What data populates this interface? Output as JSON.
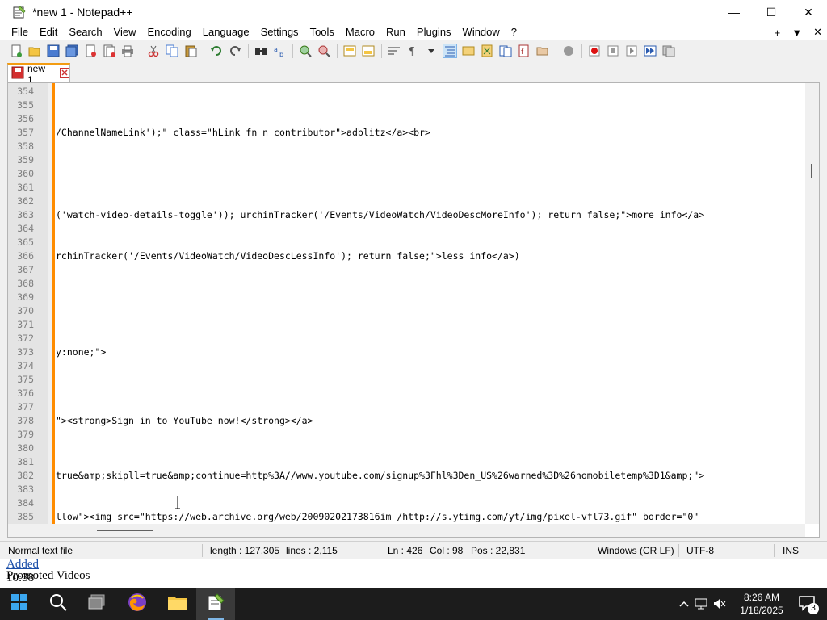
{
  "window": {
    "title": "*new 1 - Notepad++",
    "minimize": "—",
    "maximize": "☐",
    "close": "✕"
  },
  "menu": {
    "items": [
      "File",
      "Edit",
      "Search",
      "View",
      "Encoding",
      "Language",
      "Settings",
      "Tools",
      "Macro",
      "Run",
      "Plugins",
      "Window",
      "?"
    ],
    "right": [
      "+",
      "▼",
      "✕"
    ]
  },
  "tab": {
    "label": "new 1"
  },
  "editor": {
    "lines": [
      {
        "num": "354",
        "text": ""
      },
      {
        "num": "355",
        "text": ""
      },
      {
        "num": "356",
        "text": ""
      },
      {
        "num": "357",
        "text": "/ChannelNameLink');\" class=\"hLink fn n contributor\">adblitz</a><br>"
      },
      {
        "num": "358",
        "text": ""
      },
      {
        "num": "359",
        "text": ""
      },
      {
        "num": "360",
        "text": ""
      },
      {
        "num": "361",
        "text": ""
      },
      {
        "num": "362",
        "text": ""
      },
      {
        "num": "363",
        "text": "('watch-video-details-toggle')); urchinTracker('/Events/VideoWatch/VideoDescMoreInfo'); return false;\">more info</a>"
      },
      {
        "num": "364",
        "text": ""
      },
      {
        "num": "365",
        "text": ""
      },
      {
        "num": "366",
        "text": "rchinTracker('/Events/VideoWatch/VideoDescLessInfo'); return false;\">less info</a>)"
      },
      {
        "num": "367",
        "text": ""
      },
      {
        "num": "368",
        "text": ""
      },
      {
        "num": "369",
        "text": ""
      },
      {
        "num": "370",
        "text": ""
      },
      {
        "num": "371",
        "text": ""
      },
      {
        "num": "372",
        "text": ""
      },
      {
        "num": "373",
        "text": "y:none;\">"
      },
      {
        "num": "374",
        "text": ""
      },
      {
        "num": "375",
        "text": ""
      },
      {
        "num": "376",
        "text": ""
      },
      {
        "num": "377",
        "text": ""
      },
      {
        "num": "378",
        "text": "\"><strong>Sign in to YouTube now!</strong></a>"
      },
      {
        "num": "379",
        "text": ""
      },
      {
        "num": "380",
        "text": ""
      },
      {
        "num": "381",
        "text": ""
      },
      {
        "num": "382",
        "text": "true&amp;skipll=true&amp;continue=http%3A//www.youtube.com/signup%3Fhl%3Den_US%26warned%3D%26nomobiletemp%3D1&amp;\">"
      },
      {
        "num": "383",
        "text": ""
      },
      {
        "num": "384",
        "text": ""
      },
      {
        "num": "385",
        "text": "llow\"><img src=\"https://web.archive.org/web/20090202173816im_/http://s.ytimg.com/yt/img/pixel-vfl73.gif\" border=\"0\""
      }
    ]
  },
  "status": {
    "file_type": "Normal text file",
    "length": "length : 127,305",
    "lines": "lines : 2,115",
    "ln": "Ln : 426",
    "col": "Col : 98",
    "pos": "Pos : 22,831",
    "eol": "Windows (CR LF)",
    "encoding": "UTF-8",
    "mode": "INS"
  },
  "background_page": {
    "link1": "Added",
    "text1": "Promoted Videos",
    "text2": "10:38"
  },
  "taskbar": {
    "time": "8:26 AM",
    "date": "1/18/2025",
    "notifications": "3"
  },
  "colors": {
    "tab_accent": "#f39c12",
    "change_bar": "#ff8c00",
    "taskbar": "#1c1c1c"
  }
}
